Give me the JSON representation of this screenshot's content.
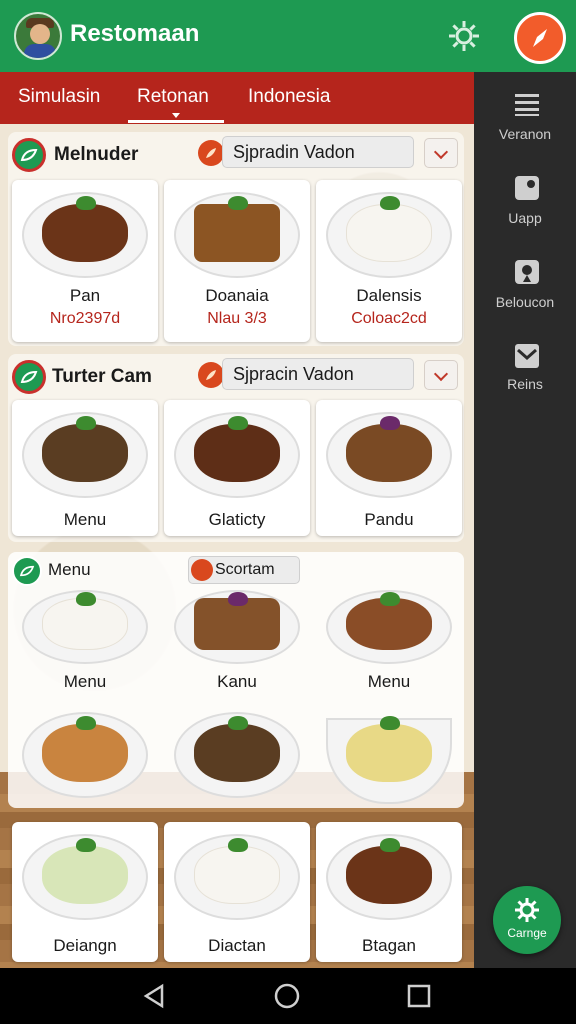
{
  "app": {
    "title": "Restomaan"
  },
  "tabs": [
    {
      "label": "Simulasin"
    },
    {
      "label": "Retonan"
    },
    {
      "label": "Indonesia"
    }
  ],
  "sections": [
    {
      "title": "Melnuder",
      "select_value": "Sjpradin Vadon",
      "cards": [
        {
          "name": "Pan",
          "price": "Nro2397d"
        },
        {
          "name": "Doanaia",
          "price": "Nlau 3/3"
        },
        {
          "name": "Dalensis",
          "price": "Coloac2cd"
        }
      ]
    },
    {
      "title": "Turter Cam",
      "select_value": "Sjpracin Vadon",
      "cards": [
        {
          "name": "Menu"
        },
        {
          "name": "Glaticty"
        },
        {
          "name": "Pandu"
        }
      ]
    },
    {
      "title": "Menu",
      "chip_label": "Scortam",
      "cards": [
        {
          "name": "Menu"
        },
        {
          "name": "Kanu"
        },
        {
          "name": "Menu"
        },
        {
          "name": ""
        },
        {
          "name": ""
        },
        {
          "name": ""
        }
      ]
    }
  ],
  "bottom_cards": [
    {
      "name": "Deiangn"
    },
    {
      "name": "Diactan"
    },
    {
      "name": "Btagan"
    }
  ],
  "sidebar": {
    "items": [
      {
        "label": "Veranon",
        "icon": "menu-icon"
      },
      {
        "label": "Uapp",
        "icon": "camera-icon"
      },
      {
        "label": "Beloucon",
        "icon": "location-icon"
      },
      {
        "label": "Reins",
        "icon": "mail-icon"
      }
    ]
  },
  "fab": {
    "label": "Carnge"
  },
  "colors": {
    "primary_green": "#1e9a52",
    "tab_red": "#b5251c",
    "accent_orange": "#f25c2b",
    "sidebar_dark": "#2a2a2a"
  }
}
